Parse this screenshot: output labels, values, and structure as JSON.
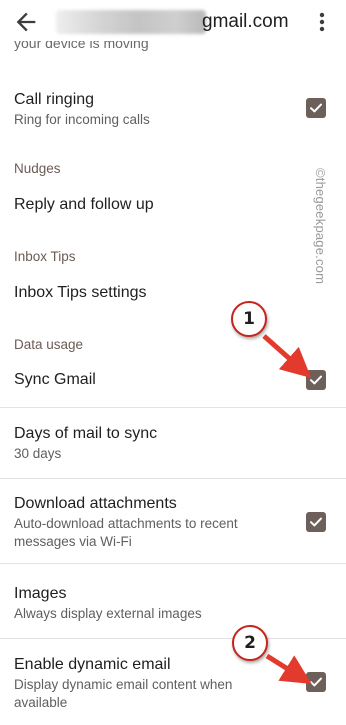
{
  "header": {
    "email_visible": "gmail.com",
    "back_icon": "arrow-back-icon",
    "more_icon": "more-vert-icon"
  },
  "top_partial_text": "your device is moving",
  "items": {
    "call_ringing": {
      "title": "Call ringing",
      "subtitle": "Ring for incoming calls",
      "checked": true
    },
    "nudges_section": "Nudges",
    "reply_follow_up": {
      "title": "Reply and follow up"
    },
    "inbox_tips_section": "Inbox Tips",
    "inbox_tips_settings": {
      "title": "Inbox Tips settings"
    },
    "data_usage_section": "Data usage",
    "sync_gmail": {
      "title": "Sync Gmail",
      "checked": true
    },
    "days_of_mail": {
      "title": "Days of mail to sync",
      "subtitle": "30 days"
    },
    "download_attachments": {
      "title": "Download attachments",
      "subtitle": "Auto-download attachments to recent messages via Wi-Fi",
      "checked": true
    },
    "images": {
      "title": "Images",
      "subtitle": "Always display external images"
    },
    "dynamic_email": {
      "title": "Enable dynamic email",
      "subtitle": "Display dynamic email content when available",
      "checked": true
    }
  },
  "annotations": {
    "badge_1": "1",
    "badge_2": "2",
    "watermark": "©thegeekpage.com"
  },
  "colors": {
    "checkbox": "#6d5f5a",
    "badge_border": "#c4261d",
    "arrow": "#e23b2e",
    "section_label": "#6b5b55"
  }
}
